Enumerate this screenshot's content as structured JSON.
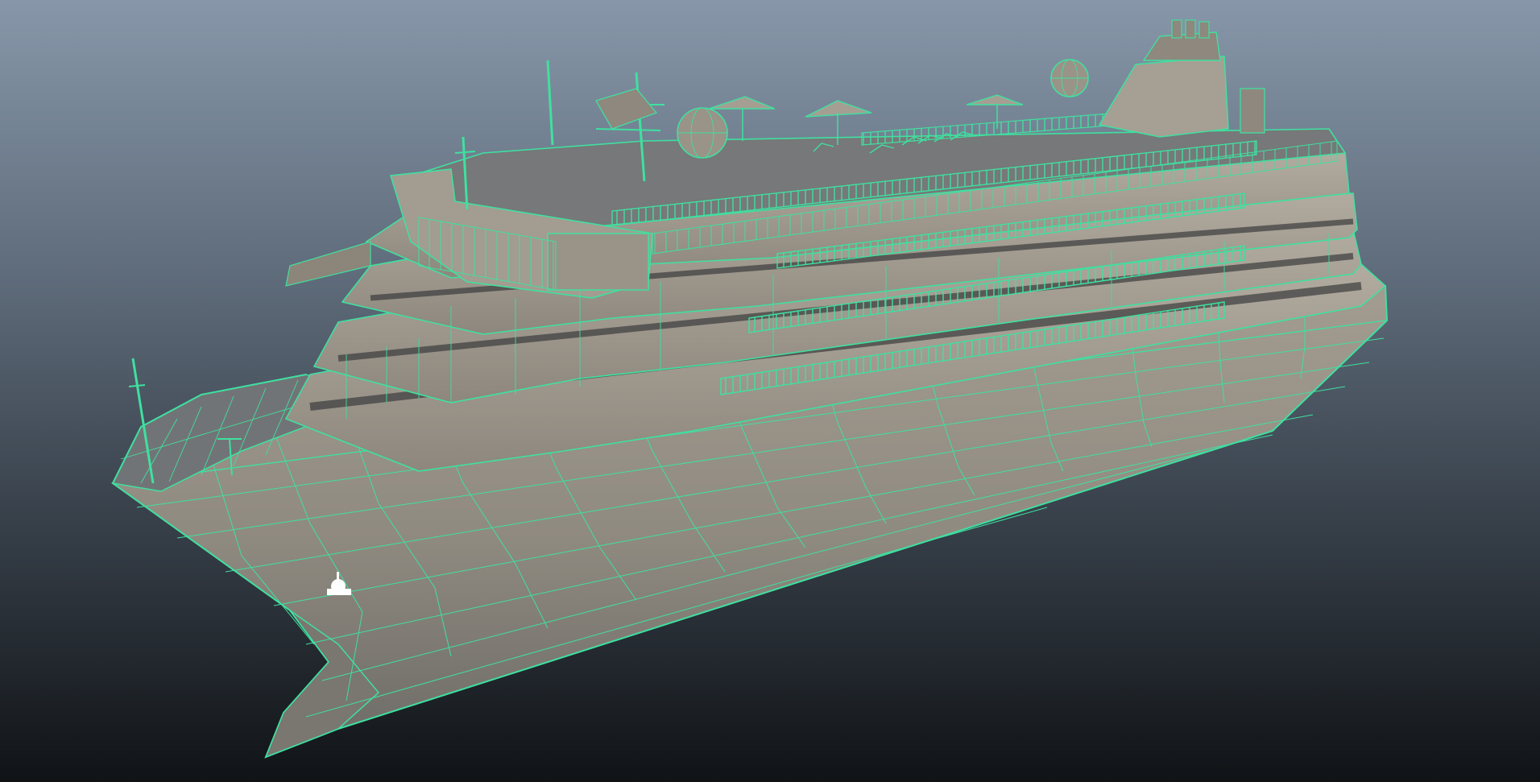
{
  "viewport": {
    "background_top": "#8797a9",
    "background_bottom": "#101316"
  },
  "scene": {
    "object": "cruise-ship",
    "display_mode": "wireframe-on-shaded",
    "wire_color": "#3fe0a0",
    "surface_color": "#9e978b",
    "surface_shadow": "#4a4b4a",
    "deck_color": "#6e7072"
  }
}
